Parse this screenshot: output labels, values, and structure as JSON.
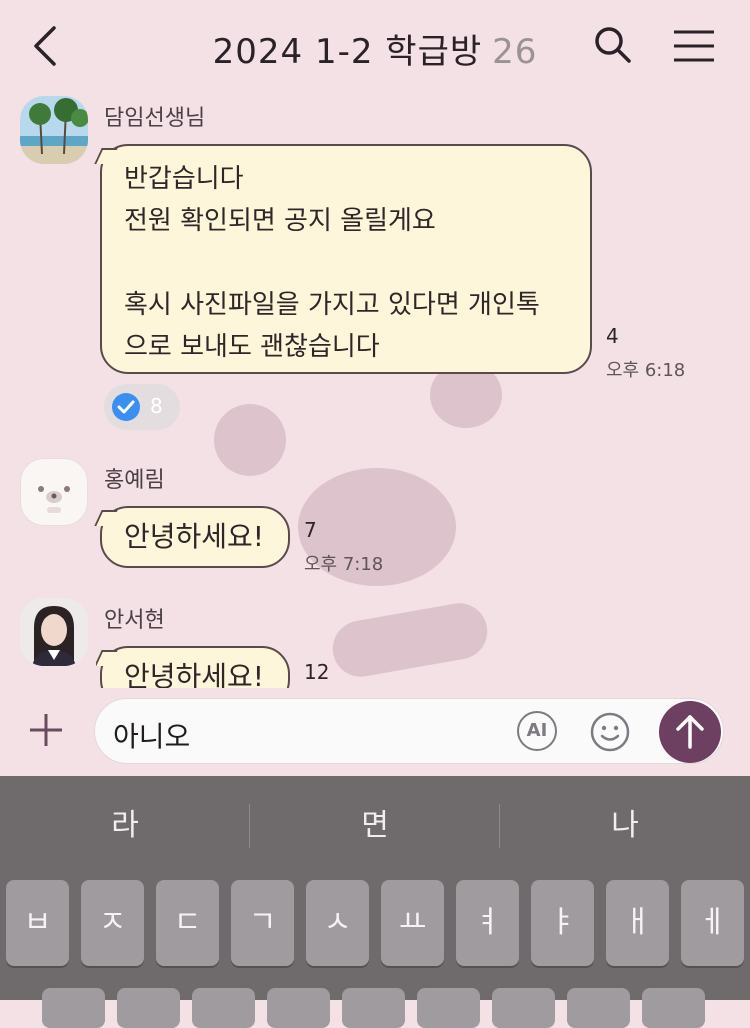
{
  "header": {
    "title": "2024 1-2 학급방",
    "member_count": "26"
  },
  "messages": [
    {
      "sender": "담임선생님",
      "lines": [
        "반갑습니다",
        "전원 확인되면 공지 올릴게요",
        "",
        "혹시 사진파일을 가지고 있다면 개인톡",
        "으로 보내도 괜찮습니다"
      ],
      "unread": "4",
      "time": "오후 6:18",
      "reaction_count": "8"
    },
    {
      "sender": "홍예림",
      "lines": [
        "안녕하세요!"
      ],
      "unread": "7",
      "time": "오후 7:18"
    },
    {
      "sender": "안서현",
      "lines": [
        "안녕하세요!"
      ],
      "unread": "12"
    }
  ],
  "input": {
    "value": "아니오",
    "ai_label": "AI"
  },
  "keyboard": {
    "suggestions": [
      "라",
      "면",
      "나"
    ],
    "row1": [
      "ㅂ",
      "ㅈ",
      "ㄷ",
      "ㄱ",
      "ㅅ",
      "ㅛ",
      "ㅕ",
      "ㅑ",
      "ㅐ",
      "ㅔ"
    ]
  },
  "colors": {
    "background": "#f3e1e6",
    "bubble": "#fdf6da",
    "send_button": "#6d3f60",
    "keyboard": "#6f6a6c",
    "reaction_check": "#3a8ff0"
  },
  "icons": {
    "back": "chevron-left-icon",
    "search": "search-icon",
    "menu": "hamburger-menu-icon",
    "plus": "plus-icon",
    "ai": "ai-icon",
    "emoji": "emoji-icon",
    "send": "send-arrow-icon",
    "check": "check-icon"
  }
}
